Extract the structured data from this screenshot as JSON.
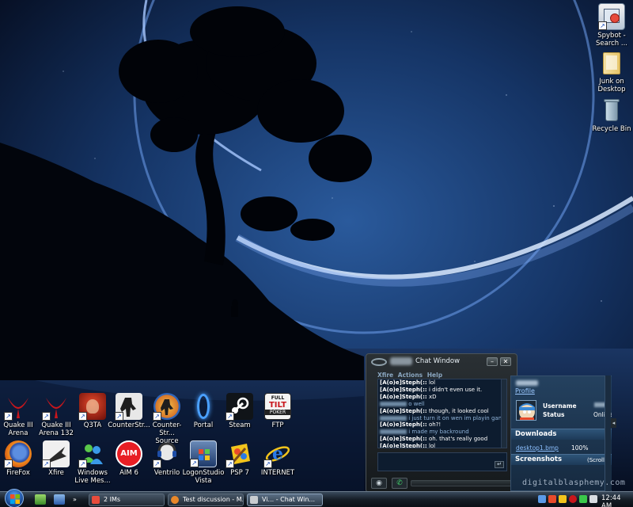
{
  "desktop": {
    "right_icons": [
      {
        "label": "Spybot -\nSearch ...",
        "icon": "spybot-icon"
      },
      {
        "label": "Junk on\nDesktop",
        "icon": "folder-icon"
      },
      {
        "label": "Recycle Bin",
        "icon": "recycle-bin-icon"
      }
    ],
    "row1_icons": [
      {
        "label": "Quake III\nArena",
        "icon": "quake3-icon"
      },
      {
        "label": "Quake III\nArena 132",
        "icon": "quake3-icon"
      },
      {
        "label": "Q3TA",
        "icon": "q3ta-icon"
      },
      {
        "label": "CounterStr...",
        "icon": "counterstrike-icon"
      },
      {
        "label": "Counter-Str...\nSource",
        "icon": "counterstrike-source-icon"
      },
      {
        "label": "Portal",
        "icon": "portal-icon"
      },
      {
        "label": "Steam",
        "icon": "steam-icon"
      },
      {
        "label": "FTP",
        "icon": "ftp-icon"
      }
    ],
    "row2_icons": [
      {
        "label": "FireFox",
        "icon": "firefox-icon"
      },
      {
        "label": "Xfire",
        "icon": "xfire-icon"
      },
      {
        "label": "Windows\nLive Mes...",
        "icon": "windows-live-messenger-icon"
      },
      {
        "label": "AIM 6",
        "icon": "aim-icon"
      },
      {
        "label": "Ventrilo",
        "icon": "ventrilo-icon"
      },
      {
        "label": "LogonStudio\nVista",
        "icon": "logonstudio-icon"
      },
      {
        "label": "PSP 7",
        "icon": "psp-icon"
      },
      {
        "label": "INTERNET",
        "icon": "internet-explorer-icon"
      }
    ],
    "ftp_badge": {
      "line1": "FULL",
      "line2": "TILT",
      "line3": "POKER"
    },
    "aim_badge": "AIM"
  },
  "chat": {
    "title": "Chat Window",
    "minimize": "–",
    "close": "✕",
    "menu": [
      "Xfire",
      "Actions",
      "Help"
    ],
    "self_name": "[A(o)e]Steph(::",
    "messages": [
      {
        "from": "self",
        "text": "lol"
      },
      {
        "from": "self",
        "text": "i didn't even use it."
      },
      {
        "from": "self",
        "text": "xD"
      },
      {
        "from": "other",
        "text": "o well"
      },
      {
        "from": "self",
        "text": "though, it looked cool"
      },
      {
        "from": "other",
        "text": "i just turn it on wen im playin games"
      },
      {
        "from": "self",
        "text": "oh?!"
      },
      {
        "from": "other",
        "text": "i made my backround"
      },
      {
        "from": "self",
        "text": "oh. that's really good"
      },
      {
        "from": "self",
        "text": "lol"
      }
    ],
    "send_glyph": "↵"
  },
  "profile": {
    "link": "Profile",
    "username_label": "Username",
    "status_label": "Status",
    "status_value": "Online",
    "downloads_title": "Downloads",
    "download_file": "desktop1.bmp",
    "download_pct": "100%",
    "screenshots_title": "Screenshots",
    "screenshots_hint": "(Scroll L"
  },
  "watermark": "digitalblasphemy.com",
  "taskbar": {
    "tasks": [
      {
        "label": "2 IMs",
        "icon_color": "#e84c3c"
      },
      {
        "label": "Test discussion - M...",
        "icon_color": "#e8882a"
      },
      {
        "label": "Vi... - Chat Win...",
        "icon_color": "#c8ccd0"
      }
    ],
    "clock": "12:44 AM"
  }
}
